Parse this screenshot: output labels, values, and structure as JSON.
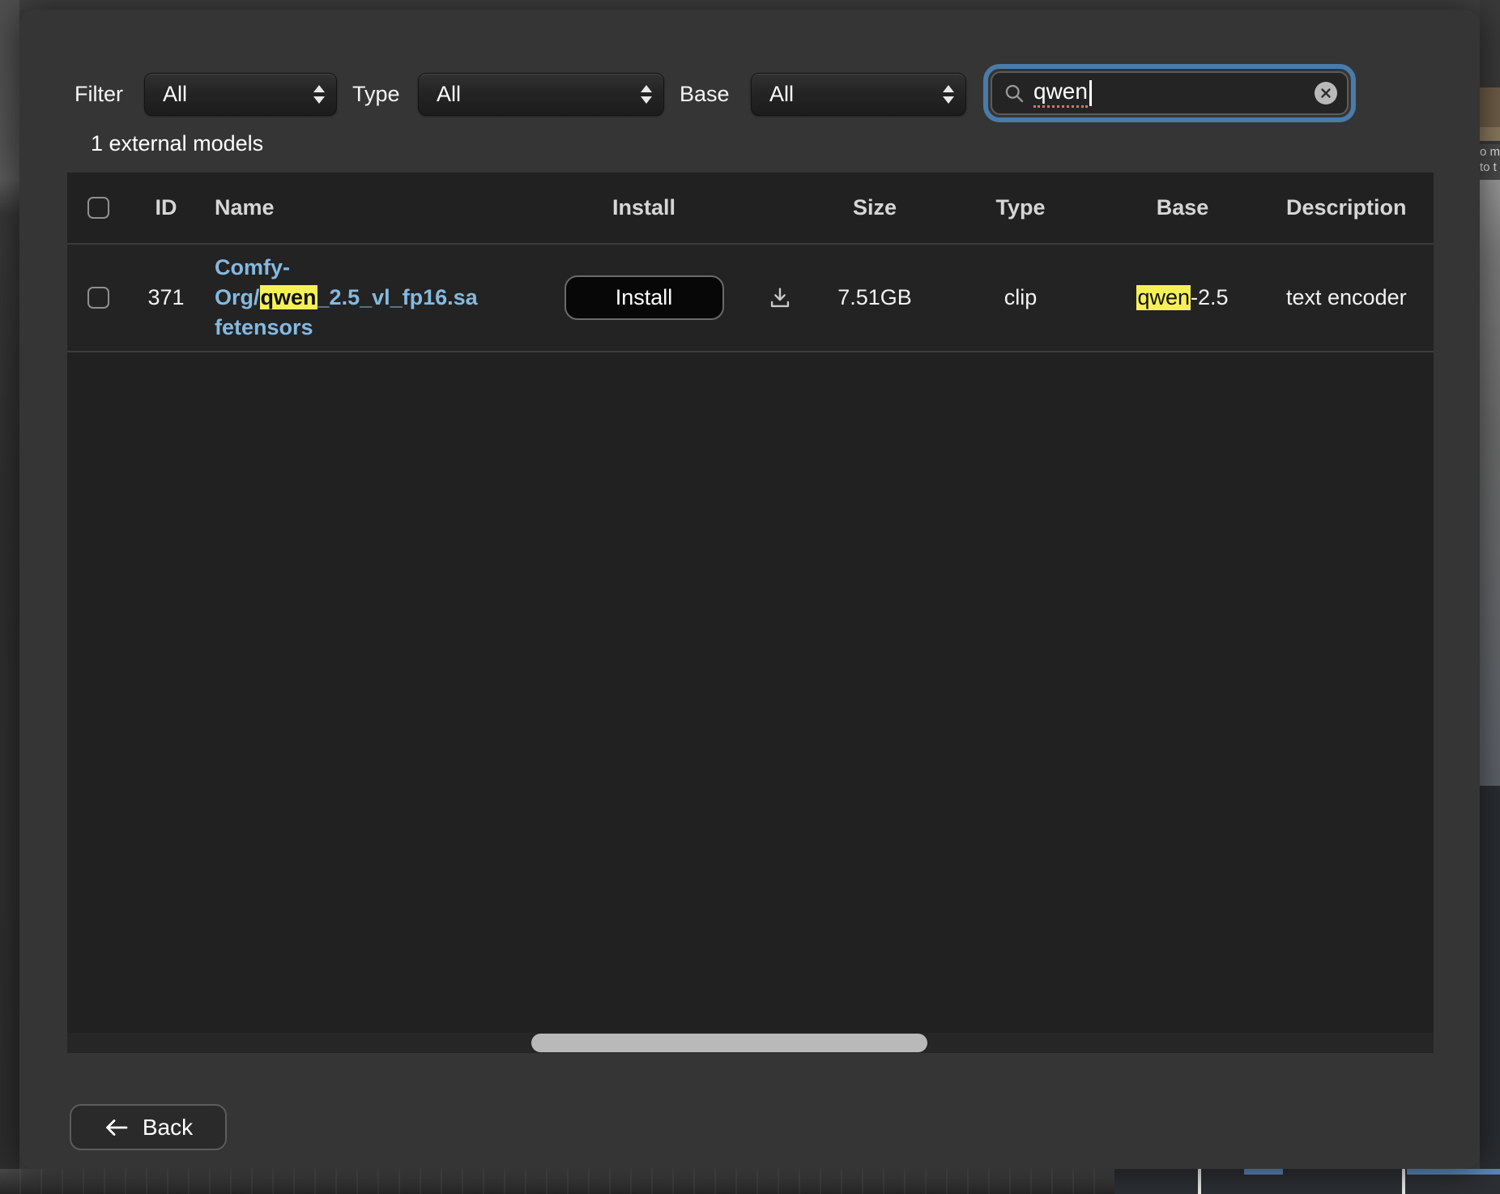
{
  "filter_bar": {
    "filter_label": "Filter",
    "filter_value": "All",
    "type_label": "Type",
    "type_value": "All",
    "base_label": "Base",
    "base_value": "All",
    "search": {
      "value": "qwen"
    }
  },
  "summary": "1 external models",
  "table": {
    "header": {
      "id": "ID",
      "name": "Name",
      "install": "Install",
      "size": "Size",
      "type": "Type",
      "base": "Base",
      "description": "Description"
    },
    "row": {
      "id": "371",
      "name_line1": "Comfy-",
      "name_line2_pre": "Org/",
      "name_highlight": "qwen",
      "name_line2_post": "_2.5_vl_fp16.sa",
      "name_line3": "fetensors",
      "install_label": "Install",
      "size": "7.51GB",
      "type": "clip",
      "base_highlight": "qwen",
      "base_suffix": "-2.5",
      "description": "text encoder"
    }
  },
  "back": {
    "label": "Back"
  },
  "background": {
    "snippet_line1": "o m",
    "snippet_line2": "to t"
  },
  "colors": {
    "dialog_bg": "#353535",
    "table_bg": "#212121",
    "focus_ring": "#4a7ba9",
    "link_blue": "#85b9e0",
    "highlight_yellow": "#f5f155",
    "status_blue_bar": "#5d88ba"
  }
}
